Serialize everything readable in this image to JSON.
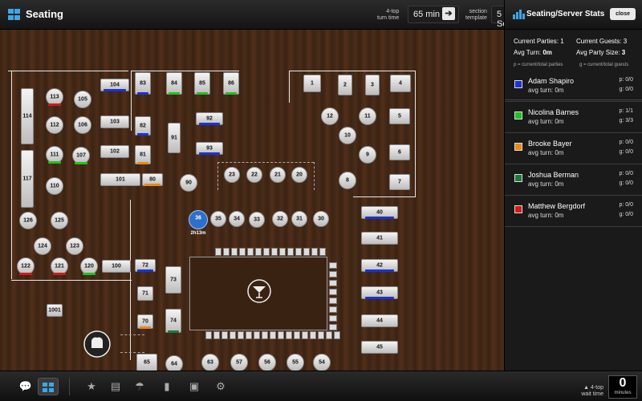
{
  "header": {
    "title": "Seating",
    "turn_label_1": "4-top",
    "turn_label_2": "turn time",
    "turn_value": "65 min",
    "section_label_1": "section",
    "section_label_2": "template",
    "section_value": "5 Se"
  },
  "floor": {
    "bar_icon": "cocktail-icon",
    "chef_icon": "chef-hat-icon",
    "selected_table": {
      "label": "36",
      "sub": "2h13m"
    },
    "tables": [
      "104",
      "83",
      "84",
      "85",
      "86",
      "113",
      "105",
      "112",
      "106",
      "103",
      "82",
      "114",
      "92",
      "111",
      "107",
      "102",
      "81",
      "91",
      "93",
      "117",
      "101",
      "80",
      "110",
      "90",
      "23",
      "22",
      "21",
      "20",
      "126",
      "125",
      "36",
      "35",
      "34",
      "33",
      "32",
      "31",
      "30",
      "124",
      "123",
      "122",
      "121",
      "120",
      "100",
      "72",
      "73",
      "71",
      "70",
      "74",
      "1001",
      "65",
      "64",
      "63",
      "57",
      "56",
      "55",
      "54",
      "1",
      "2",
      "3",
      "4",
      "12",
      "11",
      "5",
      "10",
      "9",
      "6",
      "8",
      "7",
      "40",
      "41",
      "42",
      "43",
      "44",
      "45"
    ]
  },
  "panel": {
    "title": "Seating/Server Stats",
    "close_label": "close",
    "current_parties_label": "Current Parties: 1",
    "current_guests_label": "Current Guests: 3",
    "avg_turn_label": "Avg Turn: ",
    "avg_turn_value": "0m",
    "avg_party_label": "Avg Party Size: ",
    "avg_party_value": "3",
    "legend_p": "p = current/total parties",
    "legend_g": "g = current/total guests",
    "servers": [
      {
        "name": "Adam Shapiro",
        "avg": "avg turn: 0m",
        "p": "p: 0/0",
        "g": "g: 0/0",
        "color": "#1a32d6"
      },
      {
        "name": "Nicolina Barnes",
        "avg": "avg turn: 0m",
        "p": "p: 1/1",
        "g": "g: 3/3",
        "color": "#1fc21f"
      },
      {
        "name": "Brooke Bayer",
        "avg": "avg turn: 0m",
        "p": "p: 0/0",
        "g": "g: 0/0",
        "color": "#e8891a"
      },
      {
        "name": "Joshua Berman",
        "avg": "avg turn: 0m",
        "p": "p: 0/0",
        "g": "g: 0/0",
        "color": "#1e7a3a"
      },
      {
        "name": "Matthew Bergdorf",
        "avg": "avg turn: 0m",
        "p": "p: 0/0",
        "g": "g: 0/0",
        "color": "#d11b1b"
      }
    ]
  },
  "footer": {
    "wait_label_1": "4-top",
    "wait_label_2": "wait time",
    "wait_value": "0",
    "wait_unit": "minutes",
    "icons": [
      "chat-icon",
      "seating-grid-icon",
      "star-icon",
      "document-icon",
      "server-dome-icon",
      "bar-chart-icon",
      "briefcase-icon",
      "gear-icon"
    ]
  }
}
